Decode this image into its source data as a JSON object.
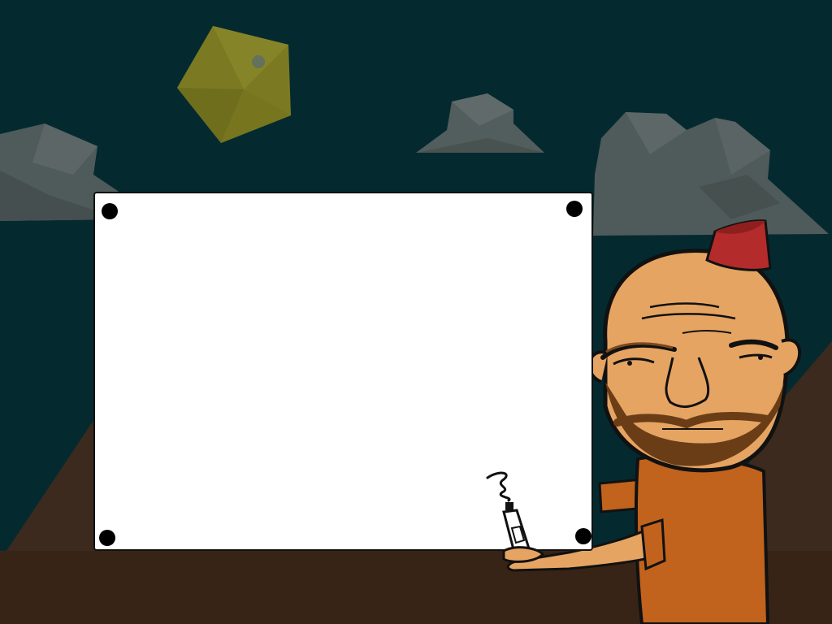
{
  "scene": {
    "name": "whiteboard-scene",
    "sky_color": "#042a30",
    "ground_color": "#372416",
    "hill_color": "#3c2a1f"
  },
  "board": {
    "text": "",
    "color": "#ffffff"
  },
  "character": {
    "hat": "fez",
    "hat_color": "#b32b2b",
    "skin_color": "#e6a462",
    "shirt_color": "#c1631d",
    "beard_color": "#6b3d17"
  },
  "held_item": "spray-bottle-icon",
  "sun": "yellow-polygon-sun"
}
